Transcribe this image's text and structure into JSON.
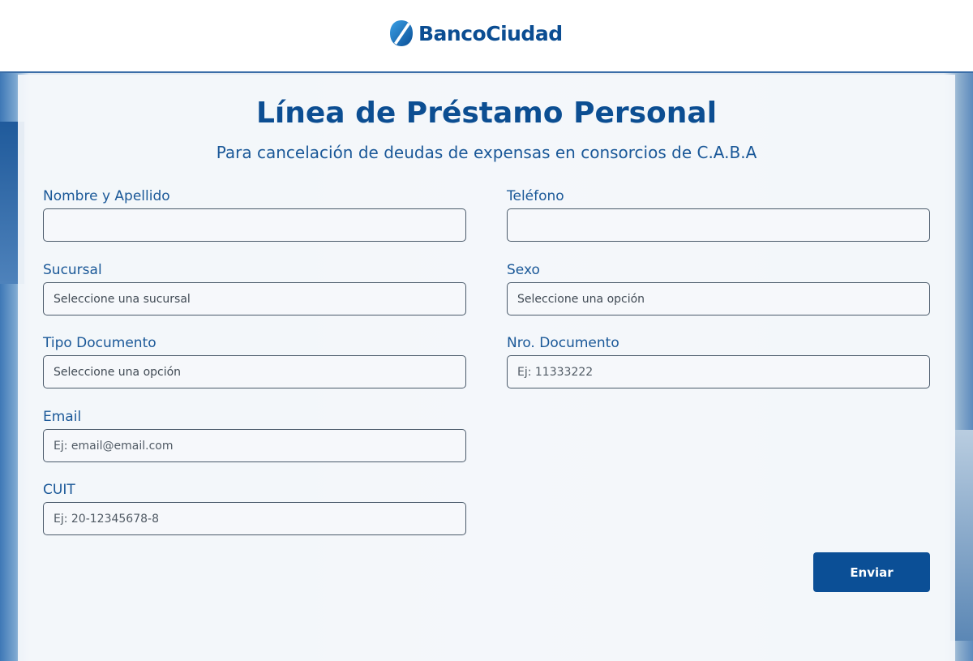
{
  "brand": {
    "name": "BancoCiudad",
    "accent_color": "#0b4f96",
    "logo_icon": "banco-ciudad-logo-icon"
  },
  "page": {
    "title": "Línea de Préstamo Personal",
    "subtitle": "Para cancelación de deudas de expensas en consorcios de C.A.B.A"
  },
  "form": {
    "nombre": {
      "label": "Nombre y Apellido",
      "value": "",
      "placeholder": ""
    },
    "telefono": {
      "label": "Teléfono",
      "value": "",
      "placeholder": ""
    },
    "sucursal": {
      "label": "Sucursal",
      "selected": "Seleccione una sucursal"
    },
    "sexo": {
      "label": "Sexo",
      "selected": "Seleccione una opción"
    },
    "tipo_documento": {
      "label": "Tipo Documento",
      "selected": "Seleccione una opción"
    },
    "nro_documento": {
      "label": "Nro. Documento",
      "value": "",
      "placeholder": "Ej: 11333222"
    },
    "email": {
      "label": "Email",
      "value": "",
      "placeholder": "Ej: email@email.com"
    },
    "cuit": {
      "label": "CUIT",
      "value": "",
      "placeholder": "Ej: 20-12345678-8"
    },
    "submit_label": "Enviar"
  }
}
